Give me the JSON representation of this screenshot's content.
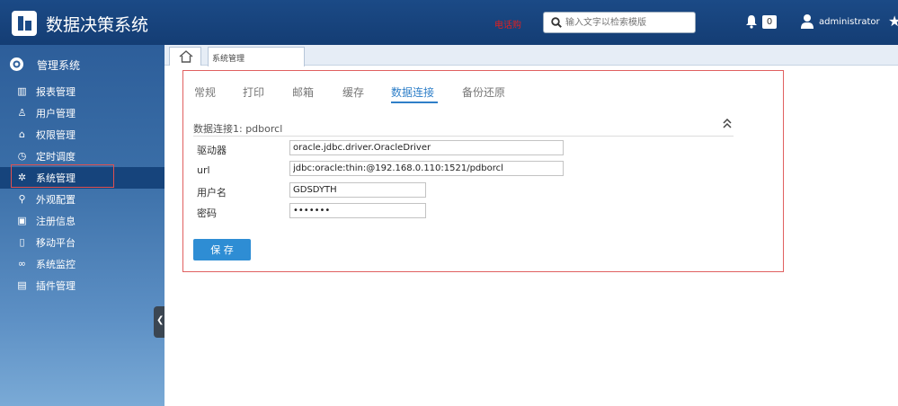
{
  "header": {
    "app_title": "数据决策系统",
    "promo_text": "电话购",
    "search_placeholder": "输入文字以检索模版",
    "notification_count": "0",
    "username": "administrator"
  },
  "sidebar": {
    "heading": "管理系统",
    "items": [
      {
        "label": "报表管理",
        "icon": "report-icon"
      },
      {
        "label": "用户管理",
        "icon": "user-icon"
      },
      {
        "label": "权限管理",
        "icon": "permission-icon"
      },
      {
        "label": "定时调度",
        "icon": "clock-icon"
      },
      {
        "label": "系统管理",
        "icon": "gear-icon",
        "active": true
      },
      {
        "label": "外观配置",
        "icon": "appearance-icon"
      },
      {
        "label": "注册信息",
        "icon": "register-icon"
      },
      {
        "label": "移动平台",
        "icon": "mobile-icon"
      },
      {
        "label": "系统监控",
        "icon": "binoculars-icon"
      },
      {
        "label": "插件管理",
        "icon": "plugin-icon"
      }
    ]
  },
  "tabs": {
    "page_tab_label": "系统管理"
  },
  "settings_tabs": [
    "常规",
    "打印",
    "邮箱",
    "缓存",
    "数据连接",
    "备份还原"
  ],
  "active_settings_tab": "数据连接",
  "connection": {
    "title": "数据连接1: pdborcl",
    "fields": [
      {
        "label": "驱动器",
        "value": "oracle.jdbc.driver.OracleDriver"
      },
      {
        "label": "url",
        "value": "jdbc:oracle:thin:@192.168.0.110:1521/pdborcl"
      },
      {
        "label": "用户名",
        "value": "GDSDYTH"
      },
      {
        "label": "密码",
        "value": "•••••••"
      }
    ],
    "save_label": "保 存"
  },
  "colors": {
    "header_bg": "#1b4a86",
    "accent": "#2f7fc8",
    "save_button": "#2e8dd4",
    "highlight_border": "#e06060"
  }
}
